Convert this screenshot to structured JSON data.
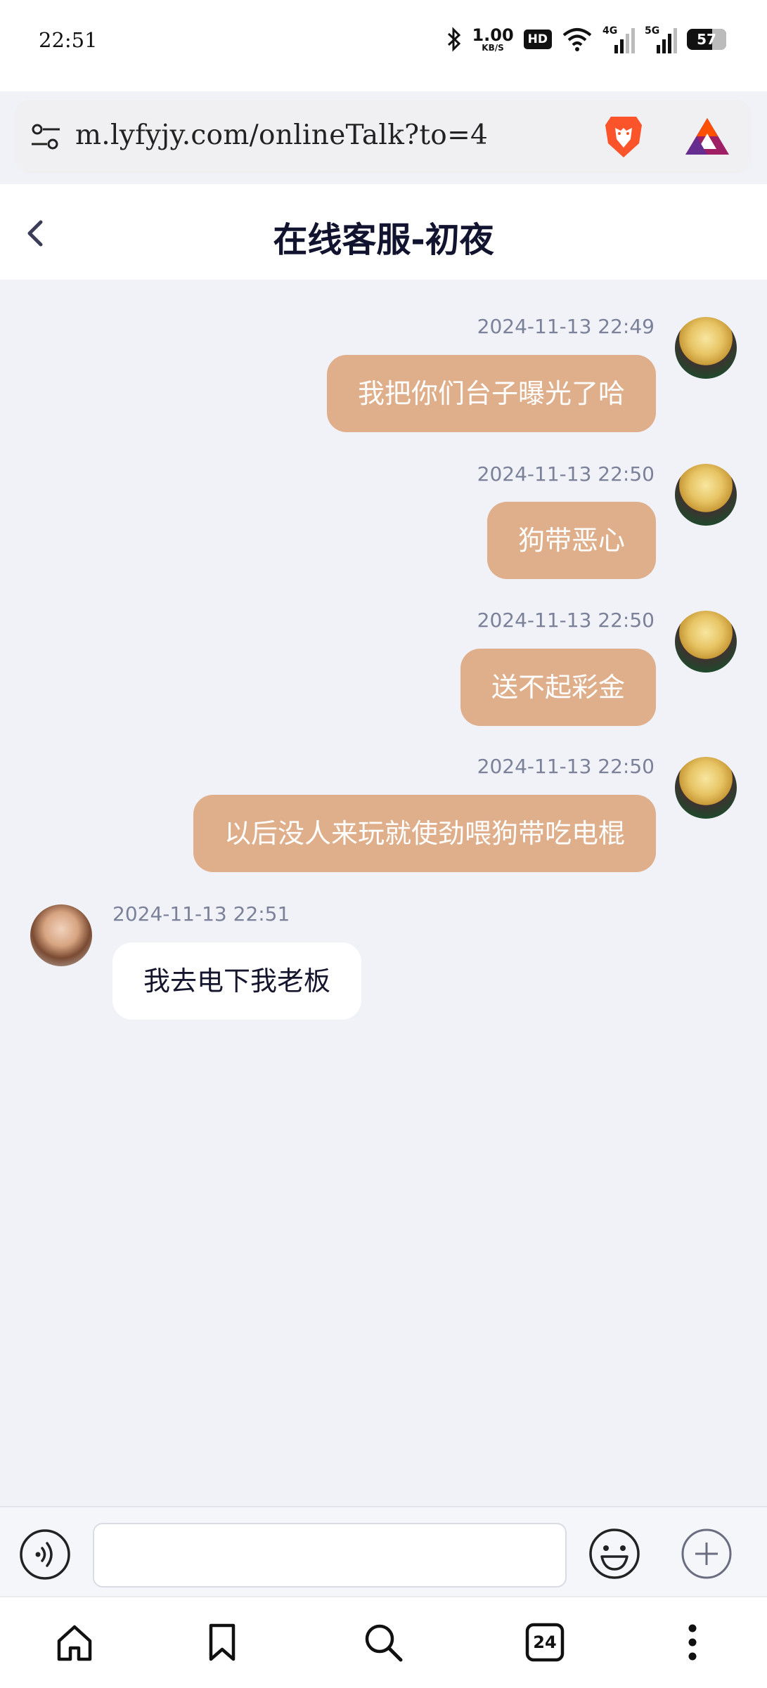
{
  "status_bar": {
    "time": "22:51",
    "net_speed_value": "1.00",
    "net_speed_unit": "KB/S",
    "hd_label": "HD",
    "network_1": "4G",
    "network_2": "5G",
    "battery": "57",
    "icons": [
      "bluetooth-icon",
      "wifi-icon",
      "signal-icon",
      "battery-icon"
    ]
  },
  "browser": {
    "url": "m.lyfyjy.com/onlineTalk?to=4",
    "icons": [
      "tune-icon",
      "brave-lion-icon",
      "bat-triangle-icon"
    ]
  },
  "header": {
    "title": "在线客服-初夜"
  },
  "messages": [
    {
      "sender": "self",
      "timestamp": "2024-11-13 22:49",
      "text": "我把你们台子曝光了哈"
    },
    {
      "sender": "self",
      "timestamp": "2024-11-13 22:50",
      "text": "狗带恶心"
    },
    {
      "sender": "self",
      "timestamp": "2024-11-13 22:50",
      "text": "送不起彩金"
    },
    {
      "sender": "self",
      "timestamp": "2024-11-13 22:50",
      "text": "以后没人来玩就使劲喂狗带吃电棍"
    },
    {
      "sender": "agent",
      "timestamp": "2024-11-13 22:51",
      "text": "我去电下我老板"
    }
  ],
  "composer": {
    "input_value": "",
    "placeholder": "",
    "icons": [
      "voice-icon",
      "emoji-icon",
      "plus-icon"
    ]
  },
  "bottom_nav": {
    "tabs_count": "24",
    "icons": [
      "home-icon",
      "bookmark-icon",
      "search-icon",
      "tabs-icon",
      "more-icon"
    ]
  },
  "colors": {
    "self_bubble": "#dfae8b",
    "agent_bubble": "#ffffff",
    "chat_background": "#f1f2f8",
    "timestamp": "#7b8198"
  }
}
